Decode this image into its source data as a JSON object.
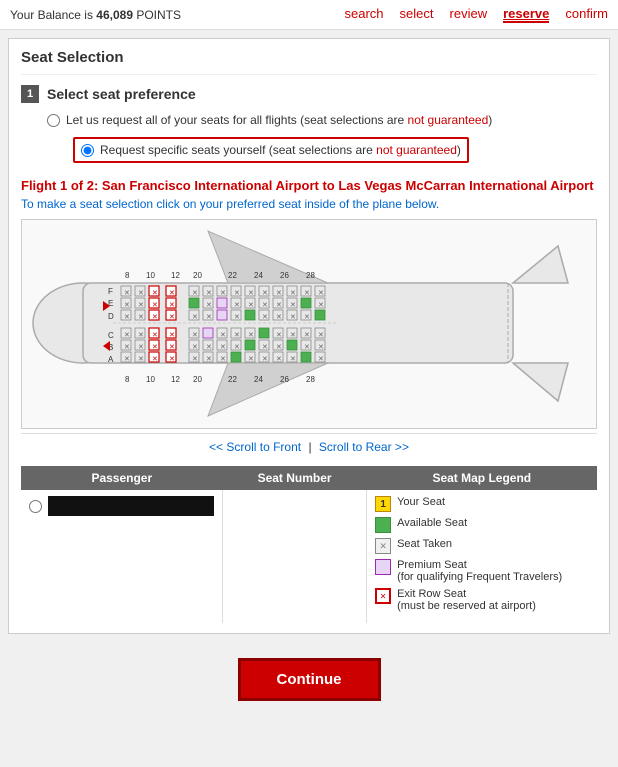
{
  "header": {
    "balance_label": "Your Balance is",
    "balance_value": "46,089",
    "balance_unit": "POINTS"
  },
  "nav": {
    "steps": [
      {
        "label": "search",
        "active": false
      },
      {
        "label": "select",
        "active": false
      },
      {
        "label": "review",
        "active": false
      },
      {
        "label": "reserve",
        "active": true
      },
      {
        "label": "confirm",
        "active": false
      }
    ]
  },
  "seat_selection": {
    "section_title": "Seat Selection",
    "step_num": "1",
    "step_label": "Select seat preference",
    "option1_label": "Let us request all of your seats for all flights (seat selections are ",
    "option1_ng": "not guaranteed",
    "option1_end": ")",
    "option2_label": "Request specific seats yourself (seat selections are ",
    "option2_ng": "not guaranteed",
    "option2_end": ")",
    "flight_title": "Flight 1 of 2: San Francisco International Airport to Las Vegas McCarran International Airport",
    "seat_instruction": "To make a seat selection click on your preferred seat inside of the plane below.",
    "scroll_front": "<< Scroll to Front",
    "scroll_separator": "|",
    "scroll_rear": "Scroll to Rear >>",
    "table": {
      "col1": "Passenger",
      "col2": "Seat Number",
      "col3": "Seat Map Legend"
    },
    "legend": [
      {
        "type": "your-seat",
        "icon": "1",
        "label": "Your Seat"
      },
      {
        "type": "avail",
        "icon": "",
        "label": "Available Seat"
      },
      {
        "type": "taken",
        "icon": "✕",
        "label": "Seat Taken"
      },
      {
        "type": "premium",
        "icon": "",
        "label": "Premium Seat\n(for qualifying Frequent Travelers)"
      },
      {
        "type": "exit-row-l",
        "icon": "✕",
        "label": "Exit Row Seat\n(must be reserved at airport)"
      }
    ]
  },
  "continue": {
    "label": "Continue"
  }
}
